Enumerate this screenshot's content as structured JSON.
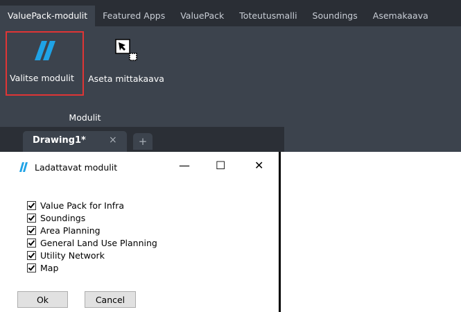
{
  "ribbon_tabs": [
    "ValuePack-modulit",
    "Featured Apps",
    "ValuePack",
    "Toteutusmalli",
    "Soundings",
    "Asemakaava"
  ],
  "ribbon": {
    "buttons": [
      {
        "label": "Valitse modulit",
        "icon": "valuepack-logo-icon"
      },
      {
        "label": "Aseta mittakaava",
        "icon": "scale-cursor-icon"
      }
    ],
    "group_label": "Modulit"
  },
  "drawing_tabs": {
    "active": "Drawing1*",
    "close": "×",
    "new": "+"
  },
  "dialog": {
    "title": "Ladattavat modulit",
    "minimize": "—",
    "maximize": "☐",
    "close": "✕",
    "modules": [
      {
        "label": "Value Pack for Infra",
        "checked": true
      },
      {
        "label": "Soundings",
        "checked": true
      },
      {
        "label": "Area Planning",
        "checked": true
      },
      {
        "label": "General Land Use Planning",
        "checked": true
      },
      {
        "label": "Utility Network",
        "checked": true
      },
      {
        "label": "Map",
        "checked": true
      }
    ],
    "ok_label": "Ok",
    "cancel_label": "Cancel"
  },
  "colors": {
    "ribbon_bg": "#3c434d",
    "tabbar_bg": "#2a2e35",
    "accent_blue": "#1fa3e6",
    "highlight_red": "#e03535"
  }
}
